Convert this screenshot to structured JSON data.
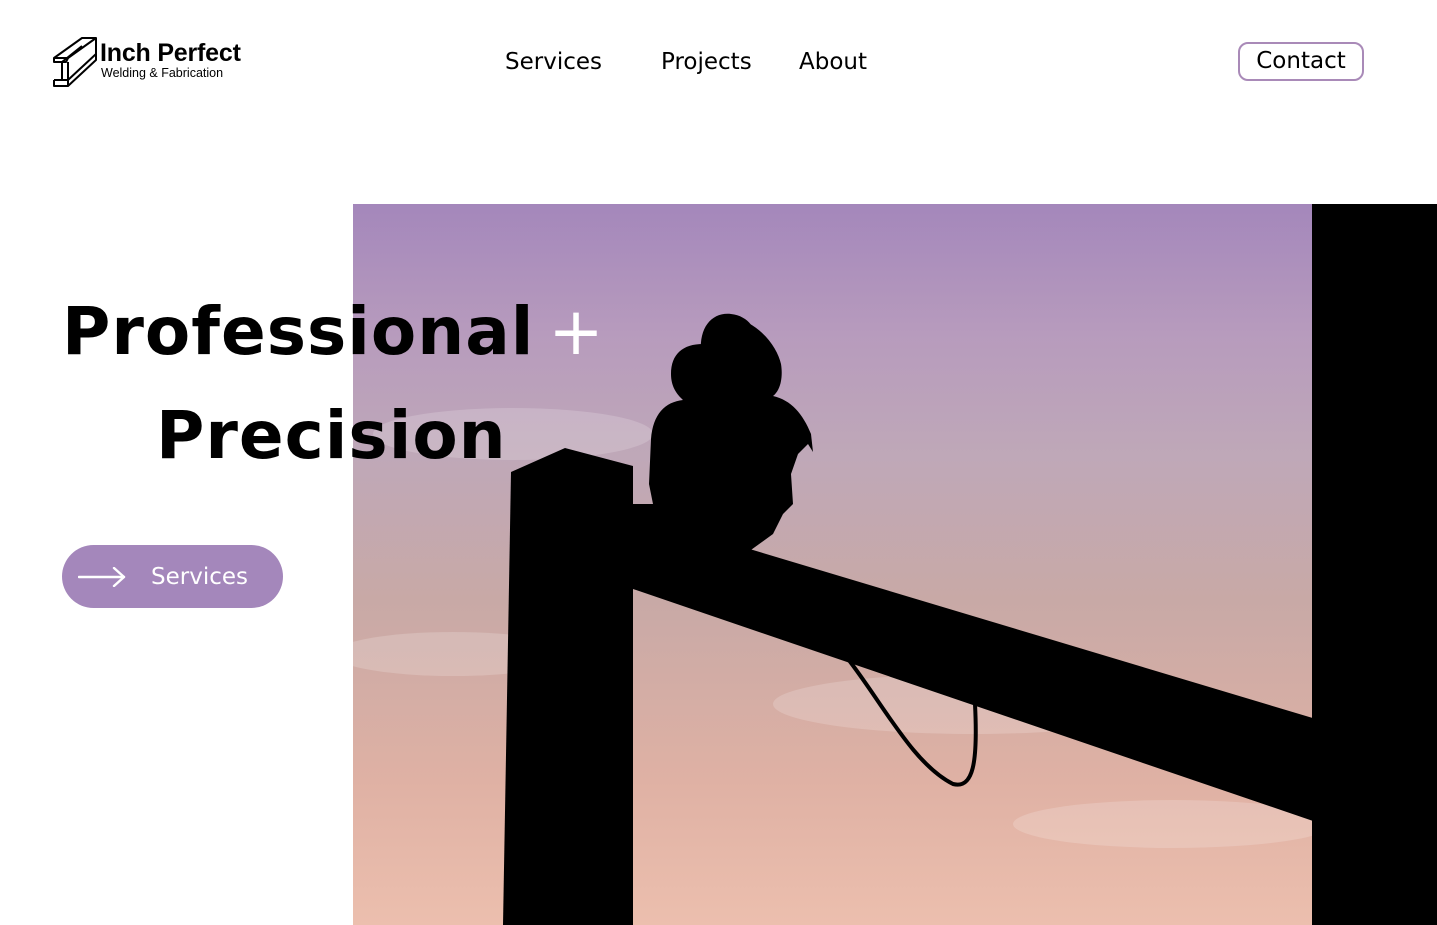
{
  "brand": {
    "name": "Inch Perfect",
    "tagline": "Welding & Fabrication",
    "logo_icon": "i-beam-logo-icon"
  },
  "nav": {
    "items": [
      {
        "label": "Services"
      },
      {
        "label": "Projects"
      },
      {
        "label": "About"
      }
    ],
    "contact_label": "Contact"
  },
  "hero": {
    "headline_line1": "Professional",
    "headline_plus": "+",
    "headline_line2": "Precision",
    "cta_label": "Services",
    "cta_icon": "arrow-right-icon",
    "image_subject": "silhouette-welder-on-steel-beam"
  },
  "colors": {
    "accent": "#a487bb",
    "contact_border": "#a98ab8",
    "text": "#000000",
    "background": "#ffffff"
  }
}
